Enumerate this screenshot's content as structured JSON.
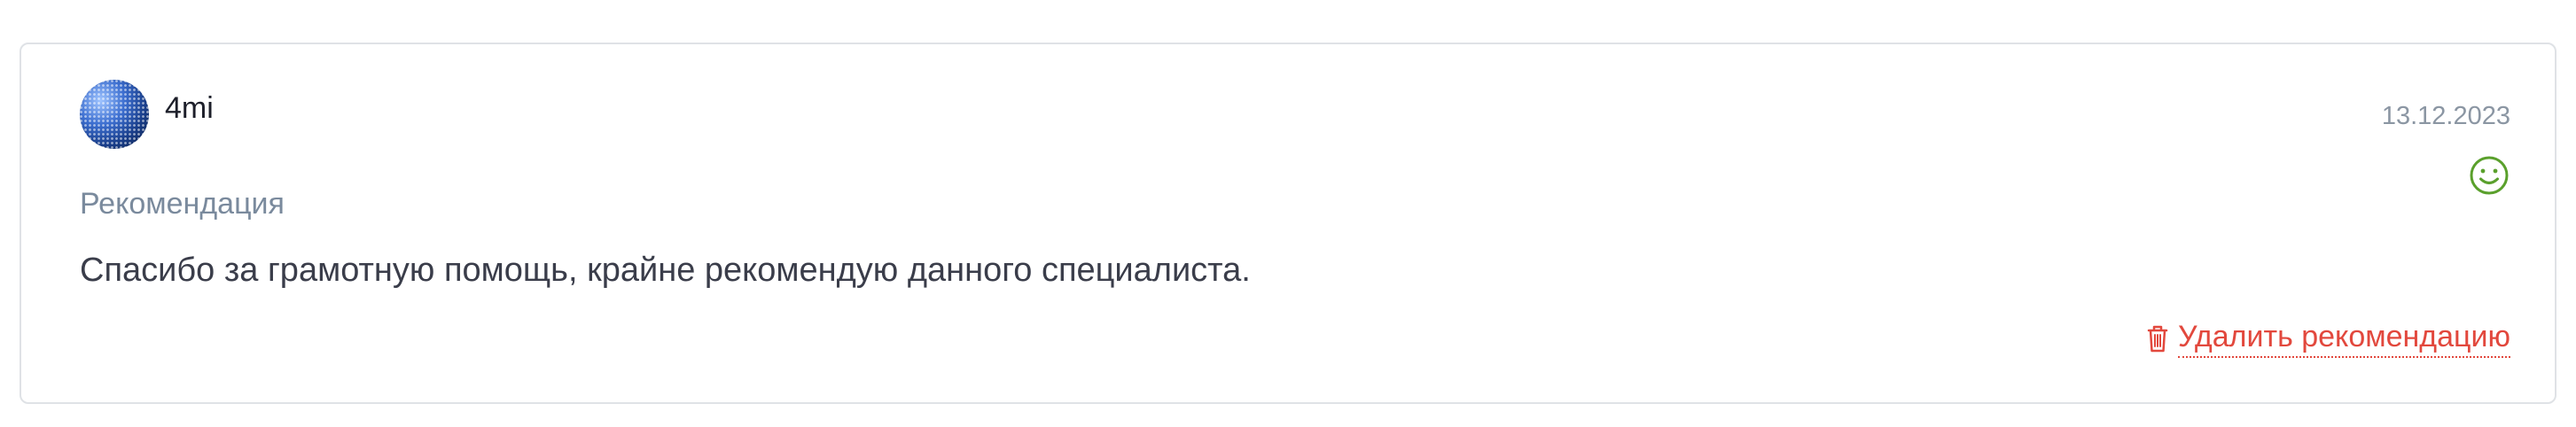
{
  "review": {
    "username": "4mi",
    "date": "13.12.2023",
    "type_label": "Рекомендация",
    "text": "Спасибо за грамотную помощь, крайне рекомендую данного специалиста.",
    "delete_label": "Удалить рекомендацию",
    "sentiment_icon": "smile-icon"
  },
  "colors": {
    "delete": "#e2483d",
    "smile": "#5aa02c",
    "muted": "#8b96a3"
  }
}
